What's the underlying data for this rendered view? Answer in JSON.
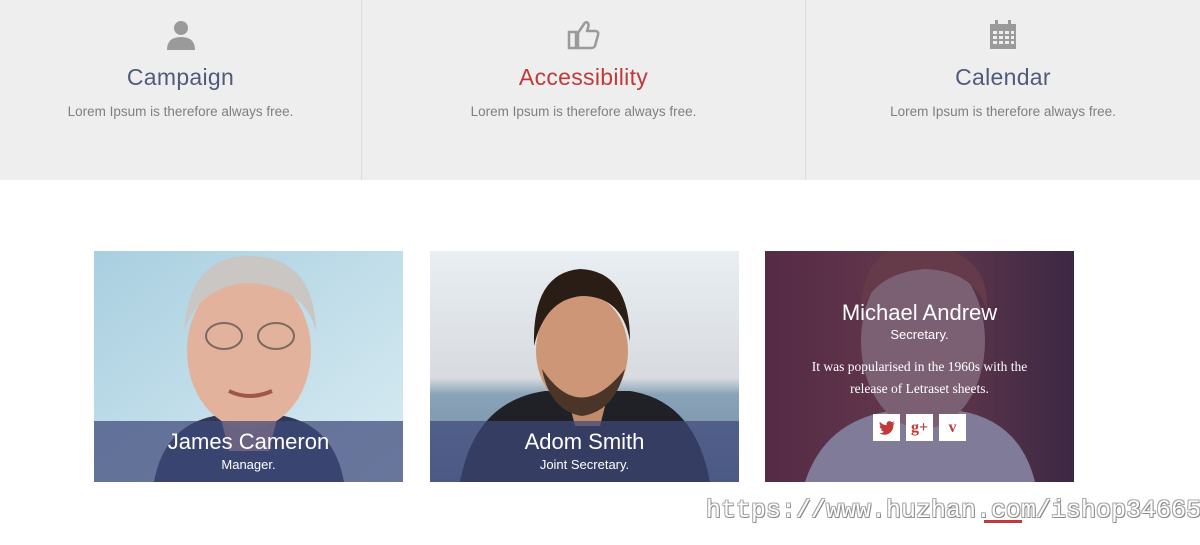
{
  "features": [
    {
      "icon": "user-icon",
      "title": "Campaign",
      "description": "Lorem Ipsum is therefore always free."
    },
    {
      "icon": "thumbs-up-icon",
      "title": "Accessibility",
      "description": "Lorem Ipsum is therefore always free."
    },
    {
      "icon": "calendar-icon",
      "title": "Calendar",
      "description": "Lorem Ipsum is therefore always free."
    }
  ],
  "team": [
    {
      "name": "James Cameron",
      "role": "Manager."
    },
    {
      "name": "Adom Smith",
      "role": "Joint Secretary."
    },
    {
      "name": "Michael Andrew",
      "role": "Secretary.",
      "bio": "It was popularised in the 1960s with the release of Letraset sheets.",
      "social": [
        {
          "icon": "twitter-icon"
        },
        {
          "icon": "google-plus-icon",
          "label": "g+"
        },
        {
          "icon": "vimeo-icon",
          "label": "v"
        }
      ]
    }
  ],
  "watermark": "https://www.huzhan.com/ishop34665",
  "colors": {
    "accent": "#c0393b",
    "title": "#4f5b7a",
    "caption_bg": "#3e487a"
  }
}
